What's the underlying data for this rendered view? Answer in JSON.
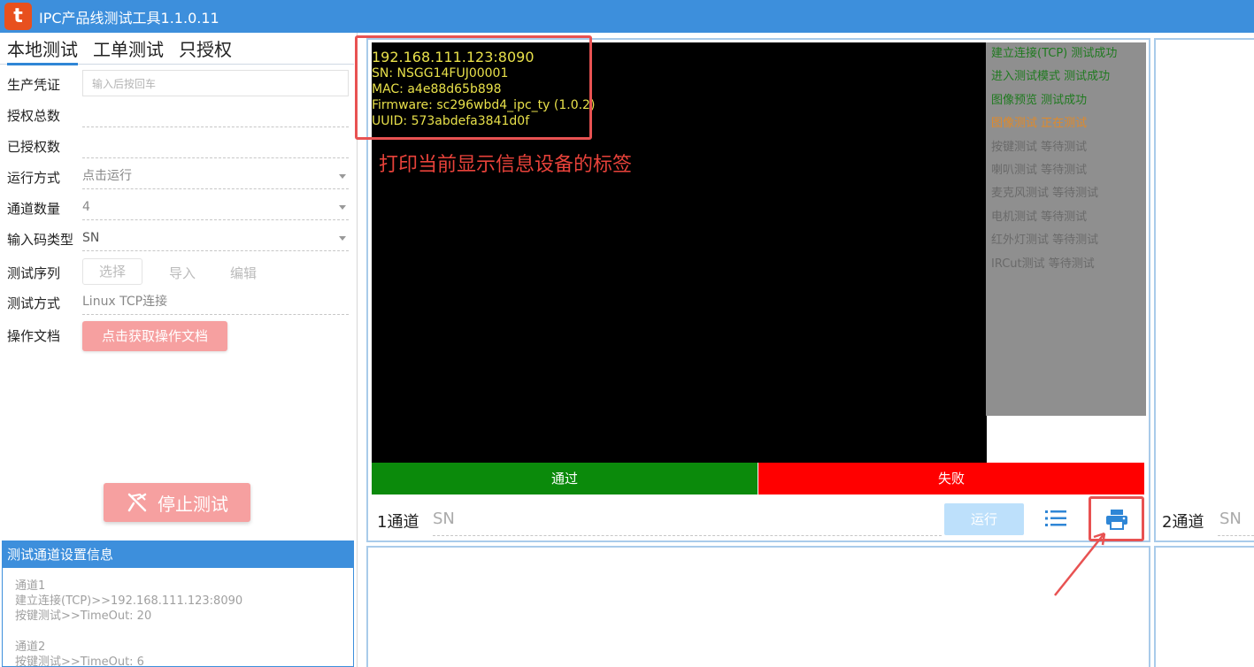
{
  "window": {
    "title": "IPC产品线测试工具1.1.0.11",
    "logo_text": "t"
  },
  "tabs": [
    {
      "label": "本地测试",
      "active": true
    },
    {
      "label": "工单测试",
      "active": false
    },
    {
      "label": "只授权",
      "active": false
    }
  ],
  "form": {
    "production_credential": {
      "label": "生产凭证",
      "placeholder": "输入后按回车"
    },
    "auth_total": {
      "label": "授权总数",
      "value": ""
    },
    "authorized": {
      "label": "已授权数",
      "value": ""
    },
    "run_mode": {
      "label": "运行方式",
      "value": "点击运行"
    },
    "channel_count": {
      "label": "通道数量",
      "value": "4"
    },
    "input_code_type": {
      "label": "输入码类型",
      "value": "SN"
    },
    "test_sequence": {
      "label": "测试序列",
      "select": "选择",
      "import": "导入",
      "edit": "编辑"
    },
    "test_method": {
      "label": "测试方式",
      "value": "Linux TCP连接"
    },
    "operation_doc": {
      "label": "操作文档",
      "button": "点击获取操作文档"
    }
  },
  "stop_button": "停止测试",
  "info_panel": {
    "header": "测试通道设置信息",
    "lines_ch1": [
      "通道1",
      "建立连接(TCP)>>192.168.111.123:8090",
      "按键测试>>TimeOut: 20"
    ],
    "lines_ch2": [
      "通道2",
      "按键测试>>TimeOut: 6"
    ]
  },
  "channel1": {
    "ip": "192.168.111.123:8090",
    "sn": "SN: NSGG14FUJ00001",
    "mac": "MAC: a4e88d65b898",
    "firmware": "Firmware: sc296wbd4_ipc_ty (1.0.2)",
    "uuid": "UUID: 573abdefa3841d0f",
    "statuses": [
      {
        "text": "建立连接(TCP) 测试成功",
        "color": "#1f7a1f"
      },
      {
        "text": "进入测试模式 测试成功",
        "color": "#1f7a1f"
      },
      {
        "text": "图像预览 测试成功",
        "color": "#1f7a1f"
      },
      {
        "text": "图像测试 正在测试",
        "color": "#e08a2a"
      },
      {
        "text": "按键测试 等待测试",
        "color": "#6a6a6a"
      },
      {
        "text": "喇叭测试 等待测试",
        "color": "#6a6a6a"
      },
      {
        "text": "麦克风测试 等待测试",
        "color": "#6a6a6a"
      },
      {
        "text": "电机测试 等待测试",
        "color": "#6a6a6a"
      },
      {
        "text": "红外灯测试 等待测试",
        "color": "#6a6a6a"
      },
      {
        "text": "IRCut测试 等待测试",
        "color": "#6a6a6a"
      }
    ],
    "pass_label": "通过",
    "fail_label": "失败",
    "name": "1通道",
    "sn_placeholder": "SN",
    "run_label": "运行"
  },
  "channel2": {
    "name": "2通道",
    "sn_placeholder": "SN"
  },
  "annotation": {
    "text": "打印当前显示信息设备的标签"
  },
  "colors": {
    "titlebar": "#3d8fdc",
    "pass": "#0b8a0b",
    "fail": "#ff0000",
    "accent": "#2f86d6",
    "annotation": "#e85252"
  },
  "icons": [
    "app-logo-icon",
    "stop-icon",
    "list-icon",
    "printer-icon",
    "dropdown-caret-icon"
  ]
}
